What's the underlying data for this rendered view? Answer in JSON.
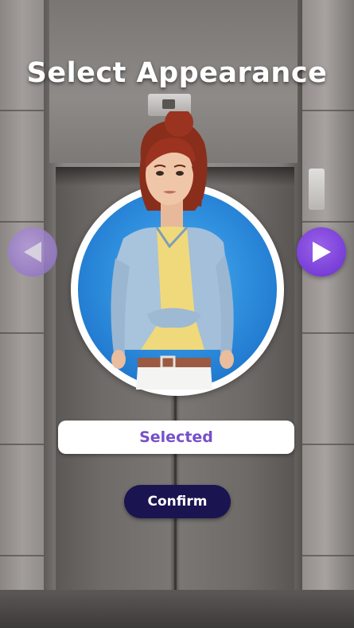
{
  "screen": {
    "title": "Select Appearance"
  },
  "avatar": {
    "description_icon": "character-portrait",
    "ring_color": "#ffffff",
    "background_color": "#2f8fde"
  },
  "navigation": {
    "prev_icon": "triangle-left-icon",
    "next_icon": "triangle-right-icon",
    "prev_color": "#a98bd8",
    "next_color": "#7a3ee0"
  },
  "status": {
    "label": "Selected",
    "color": "#7650c8"
  },
  "actions": {
    "confirm_label": "Confirm",
    "confirm_color": "#1a1550"
  }
}
